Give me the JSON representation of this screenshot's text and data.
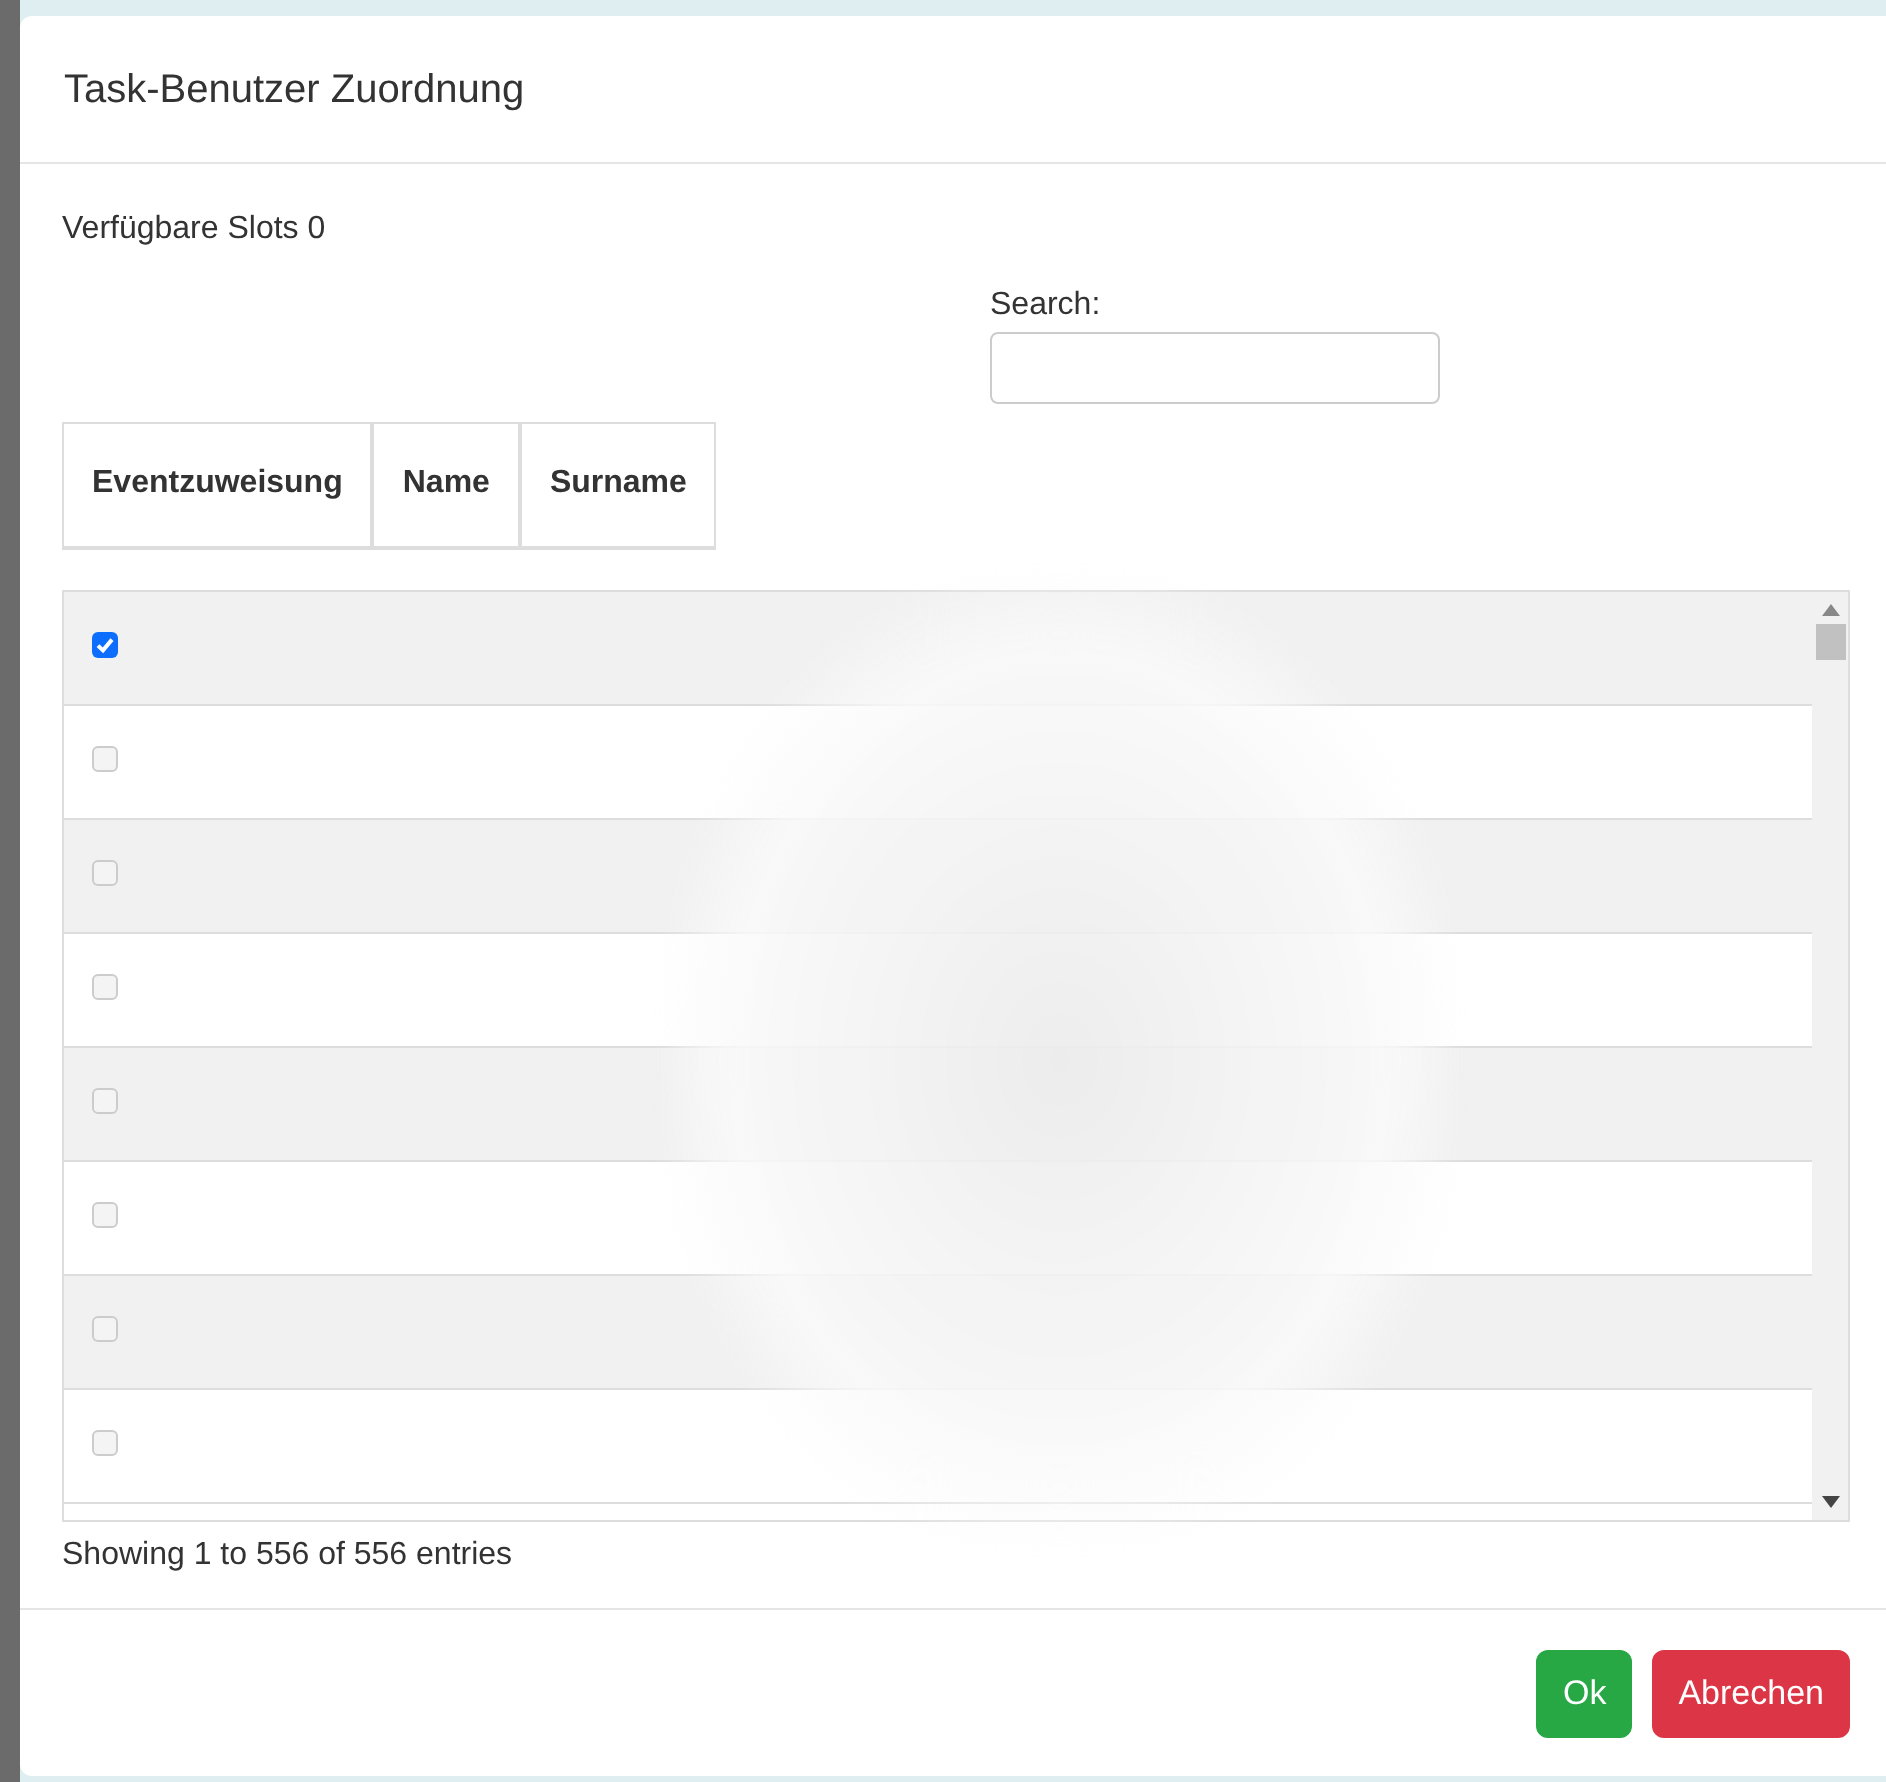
{
  "modal": {
    "title": "Task-Benutzer Zuordnung"
  },
  "slots_text": "Verfügbare Slots 0",
  "search": {
    "label": "Search:"
  },
  "table": {
    "columns": [
      "Eventzuweisung",
      "Name",
      "Surname"
    ],
    "rows": [
      {
        "checked": true
      },
      {
        "checked": false
      },
      {
        "checked": false
      },
      {
        "checked": false
      },
      {
        "checked": false
      },
      {
        "checked": false
      },
      {
        "checked": false
      },
      {
        "checked": false
      }
    ]
  },
  "info": "Showing 1 to 556 of 556 entries",
  "buttons": [
    {
      "label": "Ok",
      "kind": "success"
    },
    {
      "label": "Abrechen",
      "kind": "danger"
    }
  ]
}
